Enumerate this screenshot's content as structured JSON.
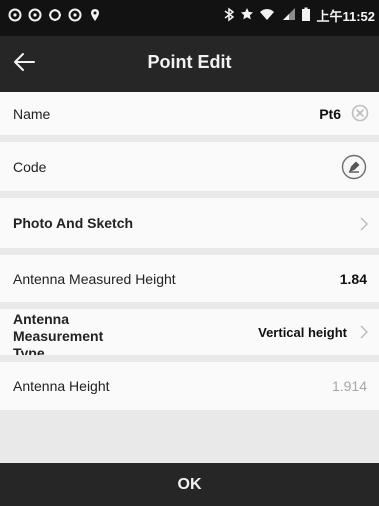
{
  "status_bar": {
    "time": "上午11:52"
  },
  "app_bar": {
    "title": "Point Edit"
  },
  "rows": [
    {
      "label": "Name",
      "value": "Pt6"
    },
    {
      "label": "Code",
      "value": ""
    },
    {
      "label": "Photo And Sketch",
      "value": ""
    },
    {
      "label": "Antenna Measured Height",
      "value": "1.84"
    },
    {
      "label": "Antenna\nMeasurement\nType",
      "value": "Vertical height"
    },
    {
      "label": "Antenna Height",
      "value": "1.914"
    }
  ],
  "footer": {
    "ok_label": "OK"
  }
}
